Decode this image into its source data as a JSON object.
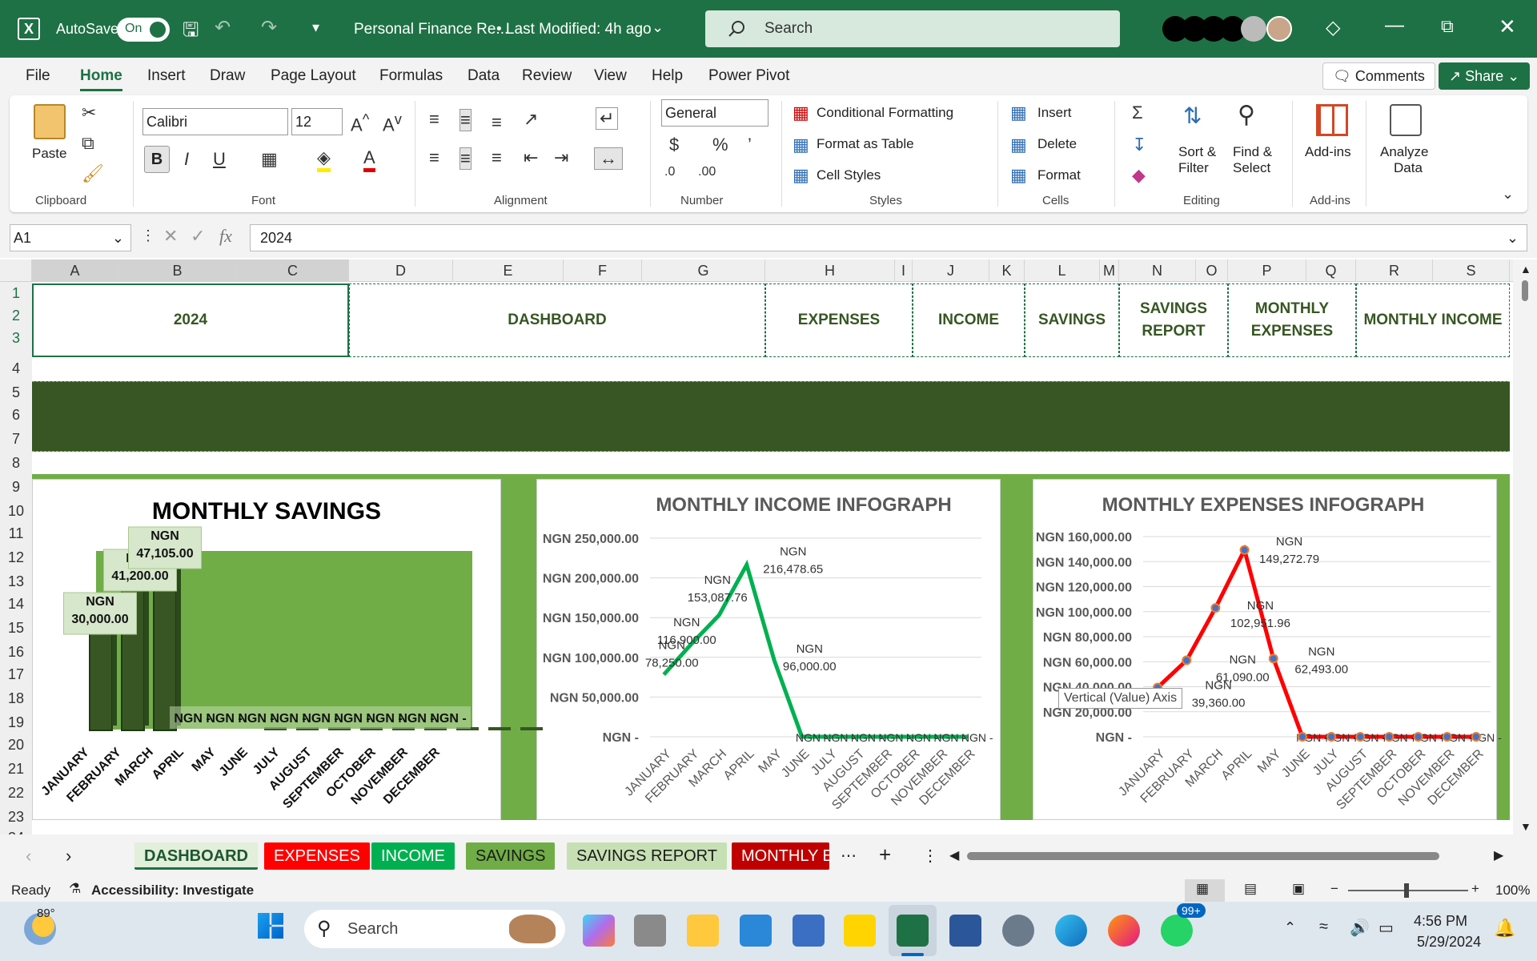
{
  "titlebar": {
    "autosave_label": "AutoSave",
    "autosave_state": "On",
    "document_title": "Personal Finance Re...",
    "last_modified": "• Last Modified: 4h ago",
    "search_placeholder": "Search"
  },
  "menu": [
    "File",
    "Home",
    "Insert",
    "Draw",
    "Page Layout",
    "Formulas",
    "Data",
    "Review",
    "View",
    "Help",
    "Power Pivot"
  ],
  "menu_right": {
    "comments": "Comments",
    "share": "Share"
  },
  "ribbon": {
    "paste": "Paste",
    "font_name": "Calibri",
    "font_size": "12",
    "number_format": "General",
    "conditional_formatting": "Conditional Formatting",
    "format_as_table": "Format as Table",
    "cell_styles": "Cell Styles",
    "insert": "Insert",
    "delete": "Delete",
    "format": "Format",
    "sort_filter_1": "Sort &",
    "sort_filter_2": "Filter",
    "find_select_1": "Find &",
    "find_select_2": "Select",
    "addins": "Add-ins",
    "analyze_1": "Analyze",
    "analyze_2": "Data",
    "groups": {
      "clipboard": "Clipboard",
      "font": "Font",
      "alignment": "Alignment",
      "number": "Number",
      "styles": "Styles",
      "cells": "Cells",
      "editing": "Editing",
      "addins": "Add-ins"
    }
  },
  "formula_bar": {
    "name_box": "A1",
    "fx": "fx",
    "value": "2024"
  },
  "columns": [
    "A",
    "B",
    "C",
    "D",
    "E",
    "F",
    "G",
    "H",
    "I",
    "J",
    "K",
    "L",
    "M",
    "N",
    "O",
    "P",
    "Q",
    "R",
    "S"
  ],
  "rows": [
    "1",
    "2",
    "3",
    "4",
    "5",
    "6",
    "7",
    "8",
    "9",
    "10",
    "11",
    "12",
    "13",
    "14",
    "15",
    "16",
    "17",
    "18",
    "19",
    "20",
    "21",
    "22",
    "23",
    "24"
  ],
  "nav_cells": [
    "2024",
    "DASHBOARD",
    "EXPENSES",
    "INCOME",
    "SAVINGS",
    "SAVINGS REPORT",
    "MONTHLY EXPENSES",
    "MONTHLY INCOME"
  ],
  "tooltip": "Vertical (Value) Axis",
  "chart_data": [
    {
      "type": "bar",
      "title": "MONTHLY SAVINGS",
      "categories": [
        "JANUARY",
        "FEBRUARY",
        "MARCH",
        "APRIL",
        "MAY",
        "JUNE",
        "JULY",
        "AUGUST",
        "SEPTEMBER",
        "OCTOBER",
        "NOVEMBER",
        "DECEMBER"
      ],
      "values": [
        30000,
        41200,
        47105,
        0,
        0,
        0,
        0,
        0,
        0,
        0,
        0,
        0
      ],
      "data_labels": [
        "NGN 30,000.00",
        "NGN 41,200.00",
        "NGN 47,105.00",
        "NGN -",
        "NGN -",
        "NGN -",
        "NGN -",
        "NGN -",
        "NGN -",
        "NGN -",
        "NGN -",
        "NGN -"
      ],
      "ylim": [
        0,
        47105
      ]
    },
    {
      "type": "line",
      "title": "MONTHLY INCOME INFOGRAPH",
      "categories": [
        "JANUARY",
        "FEBRUARY",
        "MARCH",
        "APRIL",
        "MAY",
        "JUNE",
        "JULY",
        "AUGUST",
        "SEPTEMBER",
        "OCTOBER",
        "NOVEMBER",
        "DECEMBER"
      ],
      "values": [
        78250,
        116900,
        153087.76,
        216478.65,
        96000,
        0,
        0,
        0,
        0,
        0,
        0,
        0
      ],
      "data_labels": [
        "NGN 78,250.00",
        "NGN 116,900.00",
        "NGN 153,087.76",
        "NGN 216,478.65",
        "NGN 96,000.00",
        "NGN -",
        "NGN -",
        "NGN -",
        "NGN -",
        "NGN -",
        "NGN -",
        "NGN -"
      ],
      "yticks": [
        "NGN -",
        "NGN 50,000.00",
        "NGN 100,000.00",
        "NGN 150,000.00",
        "NGN 200,000.00",
        "NGN 250,000.00"
      ],
      "ylim": [
        0,
        250000
      ],
      "color": "#00b050"
    },
    {
      "type": "line",
      "title": "MONTHLY EXPENSES INFOGRAPH",
      "categories": [
        "JANUARY",
        "FEBRUARY",
        "MARCH",
        "APRIL",
        "MAY",
        "JUNE",
        "JULY",
        "AUGUST",
        "SEPTEMBER",
        "OCTOBER",
        "NOVEMBER",
        "DECEMBER"
      ],
      "values": [
        39360,
        61090,
        102951.96,
        149272.79,
        62493,
        0,
        0,
        0,
        0,
        0,
        0,
        0
      ],
      "data_labels": [
        "NGN 39,360.00",
        "NGN 61,090.00",
        "NGN 102,951.96",
        "NGN 149,272.79",
        "NGN 62,493.00",
        "NGN -",
        "NGN -",
        "NGN -",
        "NGN -",
        "NGN -",
        "NGN -",
        "NGN -"
      ],
      "yticks": [
        "NGN -",
        "NGN 20,000.00",
        "NGN 40,000.00",
        "NGN 60,000.00",
        "NGN 80,000.00",
        "NGN 100,000.00",
        "NGN 120,000.00",
        "NGN 140,000.00",
        "NGN 160,000.00"
      ],
      "ylim": [
        0,
        160000
      ],
      "color": "#ff0000"
    }
  ],
  "sheet_tabs": [
    {
      "label": "DASHBOARD",
      "bg": "#e2efda",
      "fg": "#1e5631"
    },
    {
      "label": "EXPENSES",
      "bg": "#ff0000",
      "fg": "#ffffff"
    },
    {
      "label": "INCOME",
      "bg": "#00b050",
      "fg": "#ffffff"
    },
    {
      "label": "SAVINGS",
      "bg": "#70ad47",
      "fg": "#1a1a1a"
    },
    {
      "label": "SAVINGS REPORT",
      "bg": "#c6e0b4",
      "fg": "#1a1a1a"
    },
    {
      "label": "MONTHLY E",
      "bg": "#c00000",
      "fg": "#ffffff"
    }
  ],
  "status": {
    "ready": "Ready",
    "accessibility": "Accessibility: Investigate",
    "zoom": "100%"
  },
  "taskbar": {
    "temp": "89°",
    "search": "Search",
    "time": "4:56 PM",
    "date": "5/29/2024",
    "badge": "99+"
  }
}
